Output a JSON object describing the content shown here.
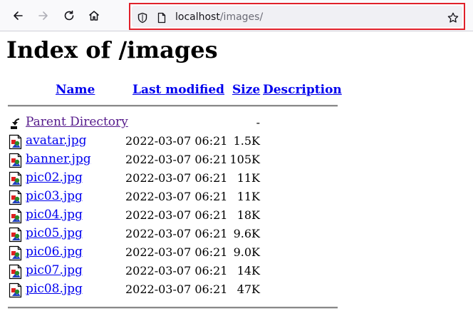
{
  "browser": {
    "url_host": "localhost",
    "url_path": "/images/"
  },
  "page": {
    "title": "Index of /images",
    "columns": {
      "name": "Name",
      "last_modified": "Last modified",
      "size": "Size",
      "description": "Description"
    },
    "parent": {
      "name": "Parent Directory",
      "size": "-"
    },
    "files": [
      {
        "name": "avatar.jpg",
        "modified": "2022-03-07 06:21",
        "size": "1.5K"
      },
      {
        "name": "banner.jpg",
        "modified": "2022-03-07 06:21",
        "size": "105K"
      },
      {
        "name": "pic02.jpg",
        "modified": "2022-03-07 06:21",
        "size": "11K"
      },
      {
        "name": "pic03.jpg",
        "modified": "2022-03-07 06:21",
        "size": "11K"
      },
      {
        "name": "pic04.jpg",
        "modified": "2022-03-07 06:21",
        "size": "18K"
      },
      {
        "name": "pic05.jpg",
        "modified": "2022-03-07 06:21",
        "size": "9.6K"
      },
      {
        "name": "pic06.jpg",
        "modified": "2022-03-07 06:21",
        "size": "9.0K"
      },
      {
        "name": "pic07.jpg",
        "modified": "2022-03-07 06:21",
        "size": "14K"
      },
      {
        "name": "pic08.jpg",
        "modified": "2022-03-07 06:21",
        "size": "47K"
      }
    ]
  },
  "colors": {
    "link": "#0000ee",
    "visited": "#551a8b",
    "url_highlight": "#e0202a"
  }
}
